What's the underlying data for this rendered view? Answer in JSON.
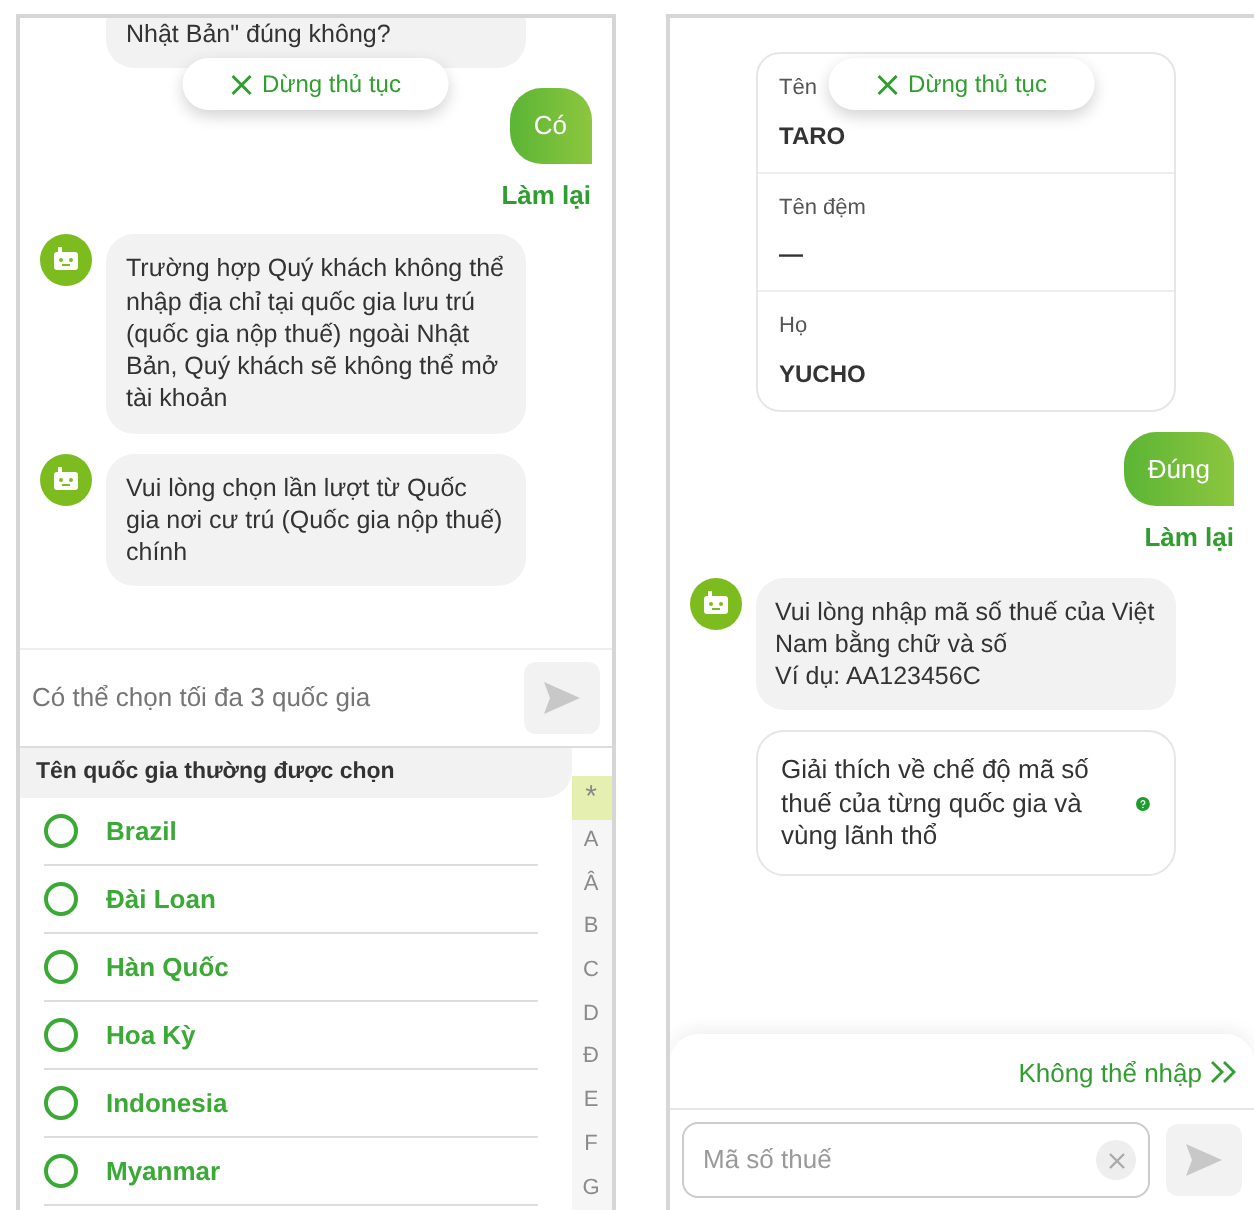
{
  "left_screen": {
    "stop_button": "Dừng thủ tục",
    "messages": [
      {
        "kind": "bot_cut",
        "text": "Nhật Bản\" đúng không?"
      },
      {
        "kind": "user",
        "text": "Có",
        "redo": "Làm lại"
      },
      {
        "kind": "bot",
        "text": "Trường hợp Quý khách không thể nhập địa chỉ tại quốc gia lưu trú (quốc gia nộp thuế) ngoài Nhật Bản, Quý khách sẽ không thể mở tài khoản"
      },
      {
        "kind": "bot",
        "text": "Vui lòng chọn lần lượt từ Quốc gia nơi cư trú (Quốc gia nộp thuế) chính"
      }
    ],
    "composer": {
      "placeholder": "Có thể chọn tối đa 3 quốc gia",
      "send_disabled": true
    },
    "country_list": {
      "header": "Tên quốc gia thường được chọn",
      "items": [
        {
          "label": "Brazil",
          "selected": false
        },
        {
          "label": "Đài Loan",
          "selected": false
        },
        {
          "label": "Hàn Quốc",
          "selected": false
        },
        {
          "label": "Hoa Kỳ",
          "selected": false
        },
        {
          "label": "Indonesia",
          "selected": false
        },
        {
          "label": "Myanmar",
          "selected": false
        }
      ],
      "index": [
        {
          "label": "*",
          "selected": true
        },
        {
          "label": "A",
          "selected": false
        },
        {
          "label": "Â",
          "selected": false
        },
        {
          "label": "B",
          "selected": false
        },
        {
          "label": "C",
          "selected": false
        },
        {
          "label": "D",
          "selected": false
        },
        {
          "label": "Đ",
          "selected": false
        },
        {
          "label": "E",
          "selected": false
        },
        {
          "label": "F",
          "selected": false
        },
        {
          "label": "G",
          "selected": false
        }
      ]
    }
  },
  "right_screen": {
    "stop_button": "Dừng thủ tục",
    "messages": [
      {
        "kind": "fields_card",
        "fields": [
          {
            "label": "Tên",
            "value": "TARO"
          },
          {
            "label": "Tên đệm",
            "value": "—"
          },
          {
            "label": "Họ",
            "value": "YUCHO"
          }
        ]
      },
      {
        "kind": "user",
        "text": "Đúng",
        "redo": "Làm lại"
      },
      {
        "kind": "bot",
        "text": "Vui lòng nhập mã số thuế của Việt Nam bằng chữ và số\nVí dụ: AA123456C"
      },
      {
        "kind": "help_card",
        "text": "Giải thích về chế độ mã số thuế của từng quốc gia và vùng lãnh thổ"
      }
    ],
    "skip_link": "Không thể nhập",
    "composer": {
      "placeholder": "Mã số thuế",
      "send_disabled": true
    }
  }
}
